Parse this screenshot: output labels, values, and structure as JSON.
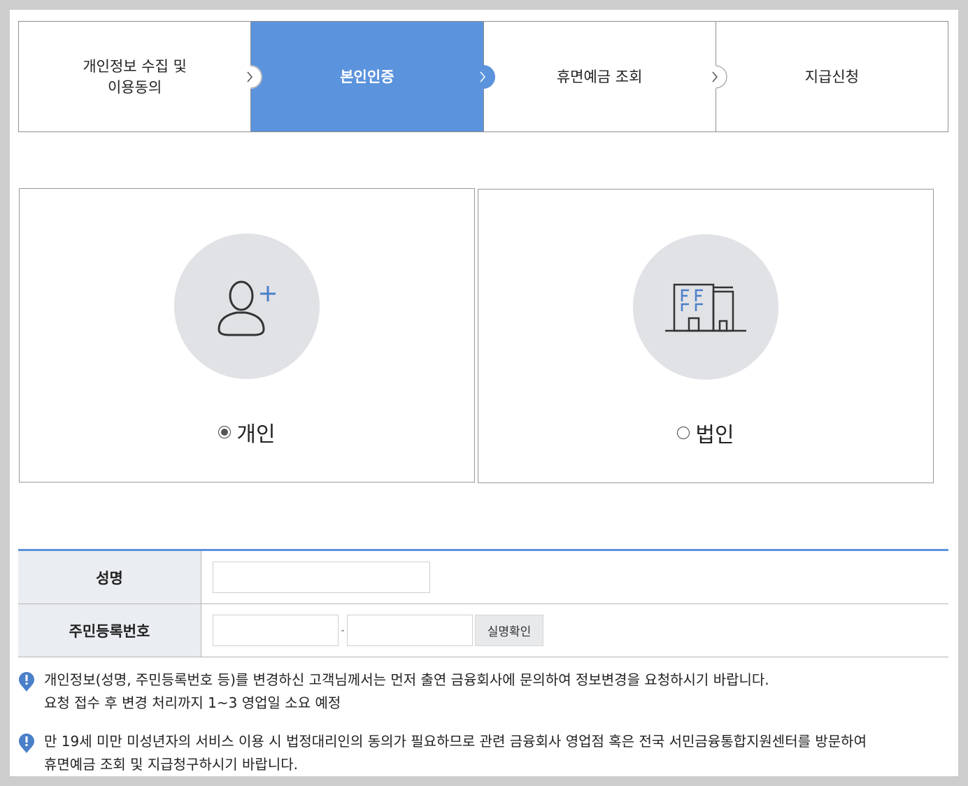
{
  "steps": [
    {
      "label": "개인정보 수집 및\n이용동의",
      "active": false
    },
    {
      "label": "본인인증",
      "active": true
    },
    {
      "label": "휴면예금 조회",
      "active": false
    },
    {
      "label": "지급신청",
      "active": false
    }
  ],
  "options": {
    "personal": {
      "label": "개인",
      "selected": true,
      "icon": "user-add-icon"
    },
    "corporate": {
      "label": "법인",
      "selected": false,
      "icon": "building-icon"
    }
  },
  "form": {
    "name_label": "성명",
    "name_value": "",
    "rrn_label": "주민등록번호",
    "rrn_front_value": "",
    "rrn_separator": "-",
    "rrn_back_value": "",
    "verify_button": "실명확인"
  },
  "notices": [
    {
      "line1": "개인정보(성명, 주민등록번호 등)를 변경하신 고객님께서는 먼저 출연 금융회사에 문의하여 정보변경을 요청하시기 바랍니다.",
      "line2": "요청 접수 후 변경 처리까지 1~3 영업일 소요 예정"
    },
    {
      "line1": "만 19세 미만 미성년자의 서비스 이용 시 법정대리인의 동의가 필요하므로 관련 금융회사 영업점 혹은 전국 서민금융통합지원센터를 방문하여",
      "line2": "휴면예금 조회 및 지급청구하시기 바랍니다."
    }
  ],
  "colors": {
    "accent": "#5b93dc",
    "circle_bg": "#e1e2e6",
    "label_bg": "#eaedf1",
    "notice_icon": "#4a7fc9"
  }
}
